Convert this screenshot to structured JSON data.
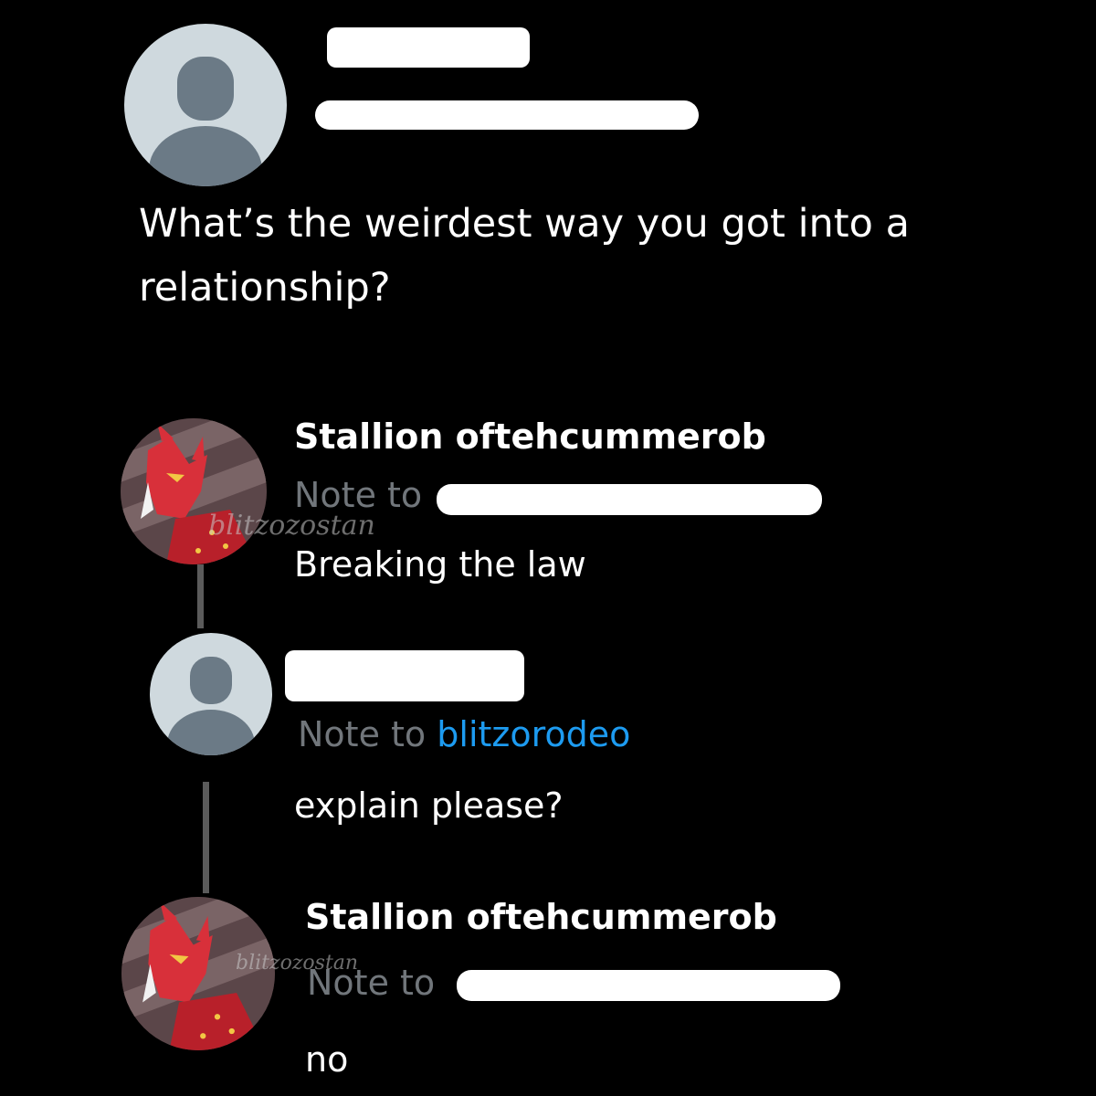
{
  "post": {
    "question": "What’s the weirdest way you got into a relationship?",
    "avatar_icon": "default-avatar-icon"
  },
  "replies": [
    {
      "author": "Stallion oftehcummerob",
      "note_prefix": "Note to",
      "text": "Breaking the law",
      "watermark": "blitzozostan",
      "avatar_icon": "character-avatar-icon"
    },
    {
      "note_prefix": "Note to",
      "note_target": "blitzorodeo",
      "text": "explain please?",
      "avatar_icon": "default-avatar-icon"
    },
    {
      "author": "Stallion oftehcummerob",
      "note_prefix": "Note to",
      "text": "no",
      "watermark": "blitzozostan",
      "avatar_icon": "character-avatar-icon"
    }
  ],
  "colors": {
    "background": "#000000",
    "link": "#1d9bf0",
    "muted": "#71767b",
    "default_avatar_bg": "#cfd9de",
    "default_avatar_fg": "#6b7a86",
    "thread_line": "#5b5b5b"
  }
}
